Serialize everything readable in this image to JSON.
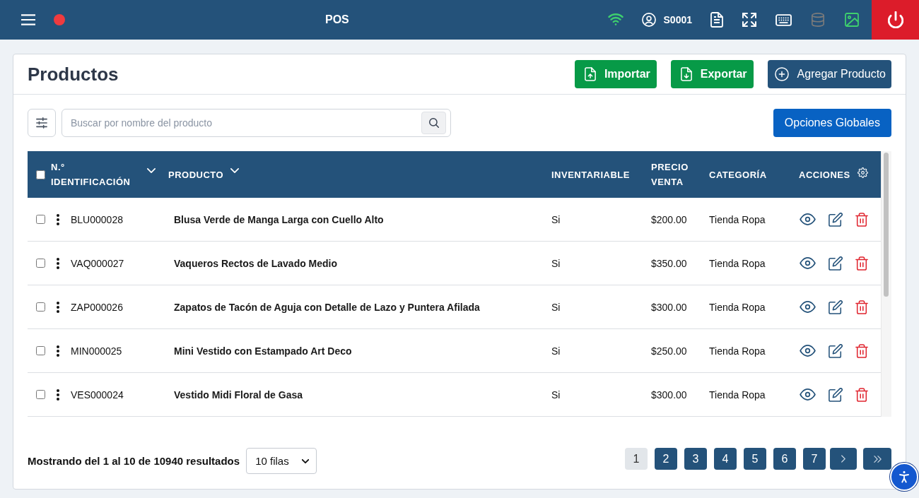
{
  "topbar": {
    "status_dot": {
      "color": "#ef3b3f"
    },
    "title": "POS",
    "tools": [
      {
        "kind": "wifi",
        "color": "#3ecf6e"
      },
      {
        "kind": "user",
        "label": "S0001",
        "color": "#ffffff"
      },
      {
        "kind": "document",
        "color": "#ffffff"
      },
      {
        "kind": "fullscreen",
        "color": "#ffffff"
      },
      {
        "kind": "keyboard",
        "color": "#ffffff"
      },
      {
        "kind": "database",
        "color": "#7b7b7b"
      },
      {
        "kind": "image",
        "color": "#3ecf6e"
      }
    ]
  },
  "page": {
    "title": "Productos",
    "actions": [
      {
        "kind": "import",
        "label": "Importar"
      },
      {
        "kind": "export",
        "label": "Exportar"
      },
      {
        "kind": "add",
        "label": "Agregar Producto"
      }
    ]
  },
  "search": {
    "placeholder": "Buscar por nombre del producto"
  },
  "global_options": "Opciones Globales",
  "table": {
    "select_all": {
      "checked": false
    },
    "columns": [
      {
        "kind": "sortable",
        "label": "N.° IDENTIFICACIÓN"
      },
      {
        "kind": "sortable",
        "label": "PRODUCTO"
      },
      {
        "kind": "plain",
        "label": "INVENTARIABLE"
      },
      {
        "kind": "plain",
        "label": "PRECIO VENTA"
      },
      {
        "kind": "plain",
        "label": "CATEGORÍA"
      },
      {
        "kind": "actions",
        "label": "ACCIONES"
      }
    ],
    "rows": [
      {
        "checked": false,
        "id": "BLU000028",
        "product": "Blusa Verde de Manga Larga con Cuello Alto",
        "inventariable": "Si",
        "price": "$200.00",
        "category": "Tienda Ropa"
      },
      {
        "checked": false,
        "id": "VAQ000027",
        "product": "Vaqueros Rectos de Lavado Medio",
        "inventariable": "Si",
        "price": "$350.00",
        "category": "Tienda Ropa"
      },
      {
        "checked": false,
        "id": "ZAP000026",
        "product": "Zapatos de Tacón de Aguja con Detalle de Lazo y Puntera Afilada",
        "inventariable": "Si",
        "price": "$300.00",
        "category": "Tienda Ropa"
      },
      {
        "checked": false,
        "id": "MIN000025",
        "product": "Mini Vestido con Estampado Art Deco",
        "inventariable": "Si",
        "price": "$250.00",
        "category": "Tienda Ropa"
      },
      {
        "checked": false,
        "id": "VES000024",
        "product": "Vestido Midi Floral de Gasa",
        "inventariable": "Si",
        "price": "$300.00",
        "category": "Tienda Ropa"
      }
    ]
  },
  "footer": {
    "summary": "Mostrando del 1 al 10 de 10940 resultados",
    "page_size": "10 filas",
    "pages": [
      {
        "label": "1",
        "selected": true
      },
      {
        "label": "2",
        "selected": false
      },
      {
        "label": "3",
        "selected": false
      },
      {
        "label": "4",
        "selected": false
      },
      {
        "label": "5",
        "selected": false
      },
      {
        "label": "6",
        "selected": false
      },
      {
        "label": "7",
        "selected": false
      }
    ]
  }
}
